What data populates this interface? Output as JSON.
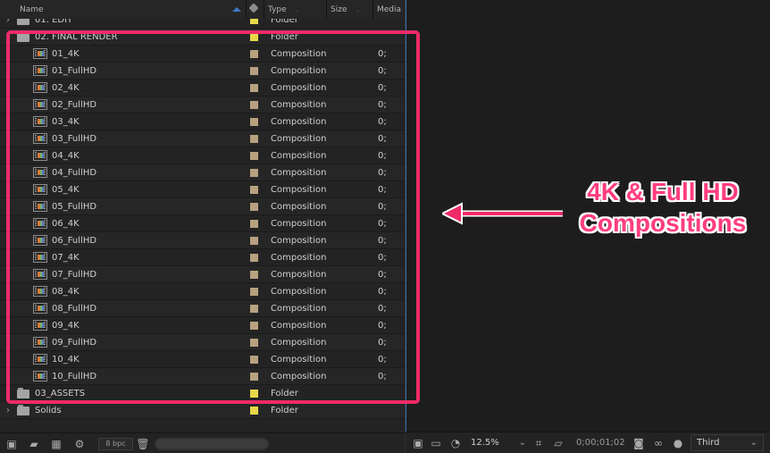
{
  "project": {
    "headers": {
      "name": "Name",
      "type": "Type",
      "size": "Size",
      "media": "Media"
    },
    "items": [
      {
        "kind": "folder",
        "name": "01. EDIT",
        "type": "Folder",
        "media": "",
        "expanded": false,
        "indent": 0,
        "label_color": "#e8d84b"
      },
      {
        "kind": "folder",
        "name": "02. FINAL RENDER",
        "type": "Folder",
        "media": "",
        "expanded": true,
        "indent": 0,
        "label_color": "#e8d84b"
      },
      {
        "kind": "composition",
        "name": "01_4K",
        "type": "Composition",
        "media": "0;",
        "indent": 1,
        "label_color": "#b7a17f"
      },
      {
        "kind": "composition",
        "name": "01_FullHD",
        "type": "Composition",
        "media": "0;",
        "indent": 1,
        "label_color": "#b7a17f"
      },
      {
        "kind": "composition",
        "name": "02_4K",
        "type": "Composition",
        "media": "0;",
        "indent": 1,
        "label_color": "#b7a17f"
      },
      {
        "kind": "composition",
        "name": "02_FullHD",
        "type": "Composition",
        "media": "0;",
        "indent": 1,
        "label_color": "#b7a17f"
      },
      {
        "kind": "composition",
        "name": "03_4K",
        "type": "Composition",
        "media": "0;",
        "indent": 1,
        "label_color": "#b7a17f"
      },
      {
        "kind": "composition",
        "name": "03_FullHD",
        "type": "Composition",
        "media": "0;",
        "indent": 1,
        "label_color": "#b7a17f"
      },
      {
        "kind": "composition",
        "name": "04_4K",
        "type": "Composition",
        "media": "0;",
        "indent": 1,
        "label_color": "#b7a17f"
      },
      {
        "kind": "composition",
        "name": "04_FullHD",
        "type": "Composition",
        "media": "0;",
        "indent": 1,
        "label_color": "#b7a17f"
      },
      {
        "kind": "composition",
        "name": "05_4K",
        "type": "Composition",
        "media": "0;",
        "indent": 1,
        "label_color": "#b7a17f"
      },
      {
        "kind": "composition",
        "name": "05_FullHD",
        "type": "Composition",
        "media": "0;",
        "indent": 1,
        "label_color": "#b7a17f"
      },
      {
        "kind": "composition",
        "name": "06_4K",
        "type": "Composition",
        "media": "0;",
        "indent": 1,
        "label_color": "#b7a17f"
      },
      {
        "kind": "composition",
        "name": "06_FullHD",
        "type": "Composition",
        "media": "0;",
        "indent": 1,
        "label_color": "#b7a17f"
      },
      {
        "kind": "composition",
        "name": "07_4K",
        "type": "Composition",
        "media": "0;",
        "indent": 1,
        "label_color": "#b7a17f"
      },
      {
        "kind": "composition",
        "name": "07_FullHD",
        "type": "Composition",
        "media": "0;",
        "indent": 1,
        "label_color": "#b7a17f"
      },
      {
        "kind": "composition",
        "name": "08_4K",
        "type": "Composition",
        "media": "0;",
        "indent": 1,
        "label_color": "#b7a17f"
      },
      {
        "kind": "composition",
        "name": "08_FullHD",
        "type": "Composition",
        "media": "0;",
        "indent": 1,
        "label_color": "#b7a17f"
      },
      {
        "kind": "composition",
        "name": "09_4K",
        "type": "Composition",
        "media": "0;",
        "indent": 1,
        "label_color": "#b7a17f"
      },
      {
        "kind": "composition",
        "name": "09_FullHD",
        "type": "Composition",
        "media": "0;",
        "indent": 1,
        "label_color": "#b7a17f"
      },
      {
        "kind": "composition",
        "name": "10_4K",
        "type": "Composition",
        "media": "0;",
        "indent": 1,
        "label_color": "#b7a17f"
      },
      {
        "kind": "composition",
        "name": "10_FullHD",
        "type": "Composition",
        "media": "0;",
        "indent": 1,
        "label_color": "#b7a17f"
      },
      {
        "kind": "folder",
        "name": "03_ASSETS",
        "type": "Folder",
        "media": "",
        "expanded": false,
        "indent": 0,
        "label_color": "#e8d84b"
      },
      {
        "kind": "folder",
        "name": "Solids",
        "type": "Folder",
        "media": "",
        "expanded": false,
        "indent": 0,
        "label_color": "#e8d84b"
      }
    ],
    "bottom_bar": {
      "bpc": "8 bpc"
    }
  },
  "viewer": {
    "zoom": "12.5%",
    "timecode": "0;00;01;02",
    "view": "Third"
  },
  "annotation": {
    "line1": "4K & Full HD",
    "line2": "Compositions",
    "color": "#ff3d7f"
  },
  "icons": {
    "sort": "sort-ascending-icon",
    "label": "tag-icon",
    "folder": "folder-icon",
    "composition": "composition-icon",
    "new_comp": "new-composition-icon",
    "delete": "trash-icon"
  }
}
